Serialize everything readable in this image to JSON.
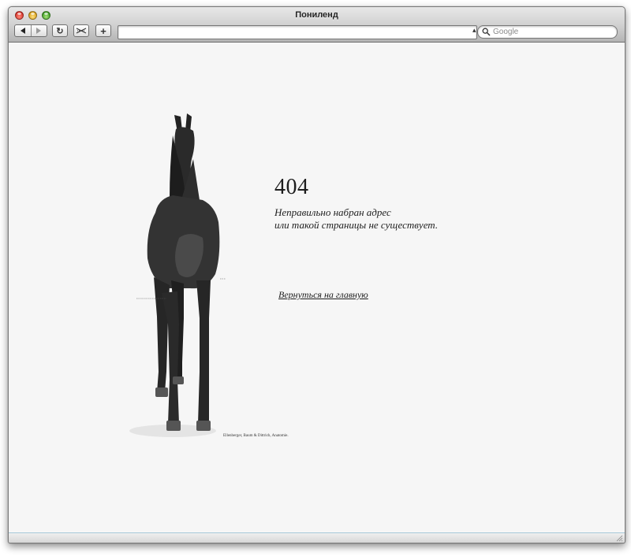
{
  "window": {
    "title": "Пониленд"
  },
  "toolbar": {
    "back_label": "back",
    "forward_label": "forward",
    "reload_symbol": "↻",
    "add_symbol": "+",
    "url_value": "",
    "rss_symbol": "▴",
    "search_placeholder": "Google"
  },
  "page": {
    "error_code": "404",
    "message_line1": "Неправильно набран адрес",
    "message_line2": "или такой страницы не существует.",
    "home_link": "Вернуться на главную",
    "illustration_caption": "Ellenberger, Baum & Dittrich, Anatomie."
  },
  "icons": {
    "close": "close-icon",
    "minimize": "minimize-icon",
    "zoom": "zoom-icon",
    "snapback": "snapback-icon",
    "search": "search-icon",
    "resize": "resize-grip-icon"
  },
  "colors": {
    "page_background": "#f6f6f6",
    "text": "#1e1e1e",
    "close": "#d9342b",
    "minimize": "#d9a01b",
    "zoom": "#3f9e24"
  }
}
